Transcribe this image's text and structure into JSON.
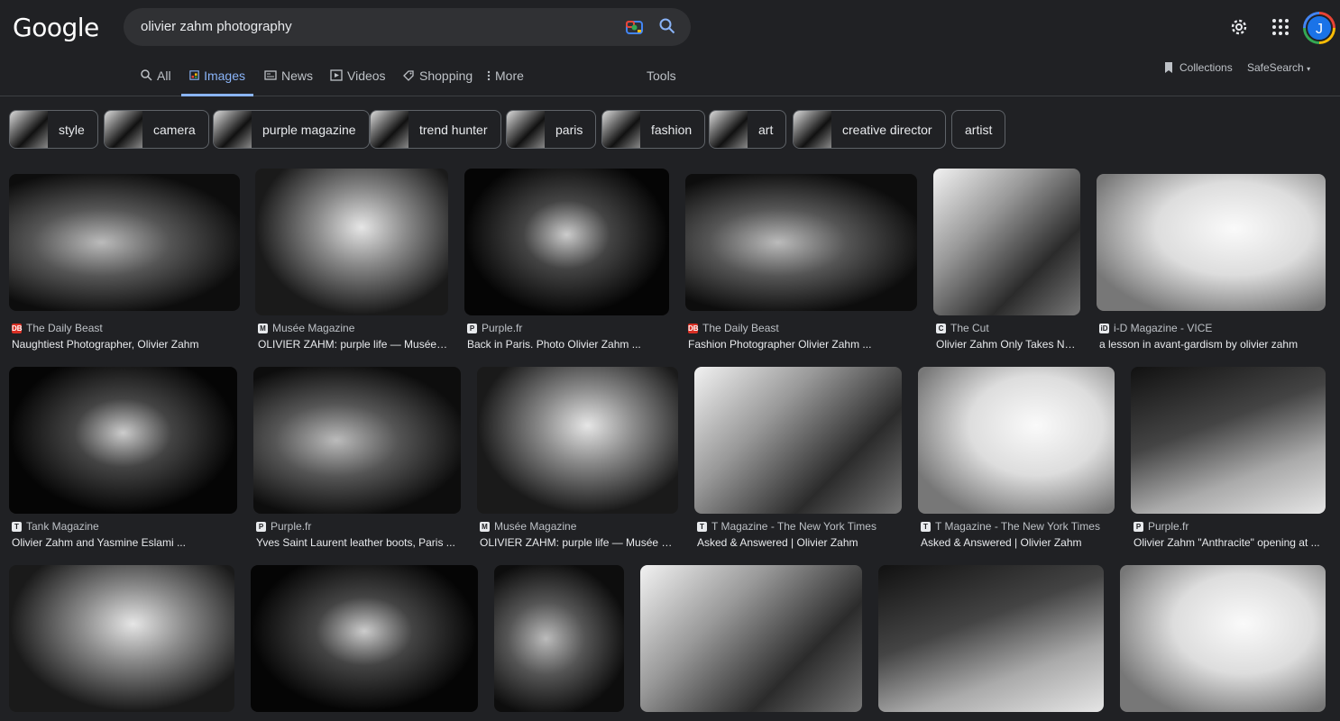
{
  "header": {
    "logo": "Google",
    "query": "olivier zahm photography",
    "avatar_letter": "J"
  },
  "tabs": [
    {
      "label": "All",
      "icon": "search-icon"
    },
    {
      "label": "Images",
      "icon": "image-icon"
    },
    {
      "label": "News",
      "icon": "news-icon"
    },
    {
      "label": "Videos",
      "icon": "video-icon"
    },
    {
      "label": "Shopping",
      "icon": "tag-icon"
    },
    {
      "label": "More",
      "icon": "more-vert-icon"
    }
  ],
  "tools_label": "Tools",
  "collections_label": "Collections",
  "safesearch_label": "SafeSearch",
  "chips": [
    "style",
    "camera",
    "purple magazine",
    "trend hunter",
    "paris",
    "fashion",
    "art",
    "creative director",
    "artist"
  ],
  "results": [
    {
      "source": "The Daily Beast",
      "title": "Naughtiest Photographer, Olivier Zahm"
    },
    {
      "source": "Musée Magazine",
      "title": "OLIVIER ZAHM: purple life — Musée Ma..."
    },
    {
      "source": "Purple.fr",
      "title": "Back in Paris. Photo Olivier Zahm ..."
    },
    {
      "source": "The Daily Beast",
      "title": "Fashion Photographer Olivier Zahm ..."
    },
    {
      "source": "The Cut",
      "title": "Olivier Zahm Only Takes Nud..."
    },
    {
      "source": "i-D Magazine - VICE",
      "title": "a lesson in avant-gardism by olivier zahm"
    },
    {
      "source": "Tank Magazine",
      "title": "Olivier Zahm and Yasmine Eslami ..."
    },
    {
      "source": "Purple.fr",
      "title": "Yves Saint Laurent leather boots, Paris ..."
    },
    {
      "source": "Musée Magazine",
      "title": "OLIVIER ZAHM: purple life — Musée Mag..."
    },
    {
      "source": "T Magazine - The New York Times",
      "title": "Asked & Answered | Olivier Zahm"
    },
    {
      "source": "T Magazine - The New York Times",
      "title": "Asked & Answered | Olivier Zahm"
    },
    {
      "source": "Purple.fr",
      "title": "Olivier Zahm \"Anthracite\" opening at ..."
    }
  ]
}
